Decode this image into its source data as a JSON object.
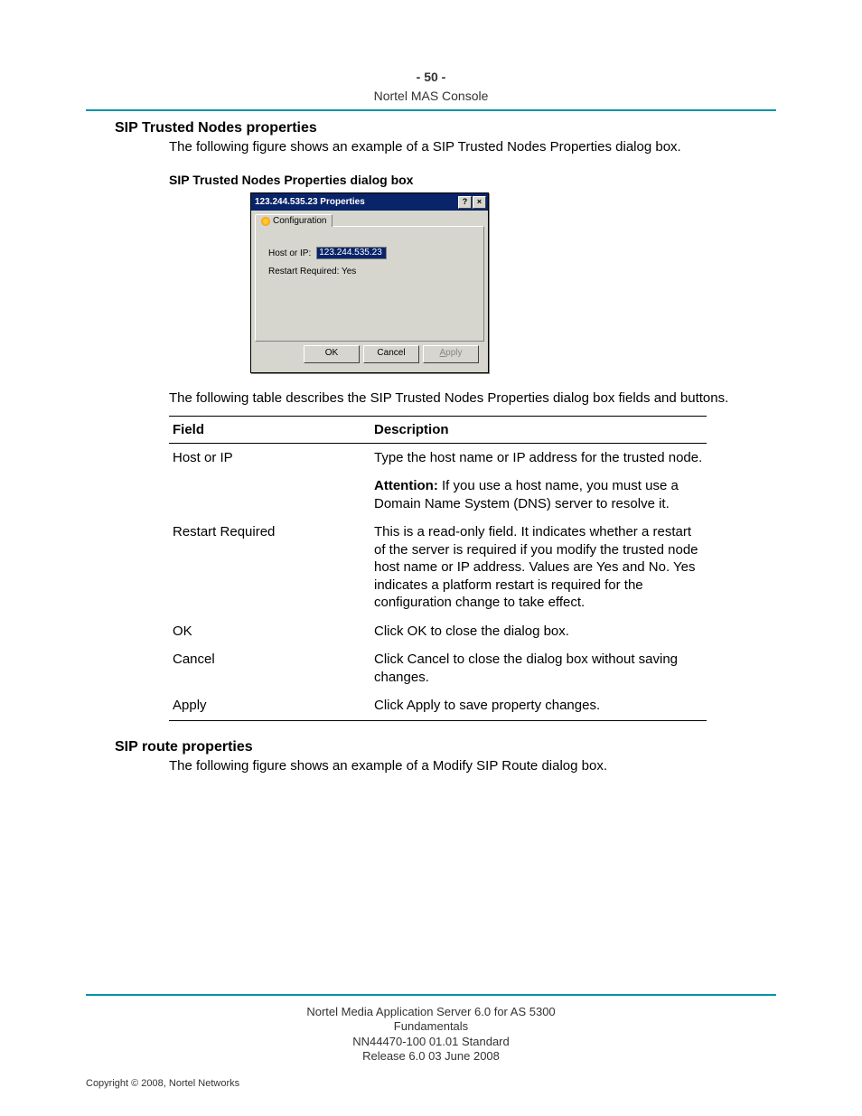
{
  "header": {
    "page_number": "- 50 -",
    "running_head": "Nortel MAS Console"
  },
  "section1": {
    "title": "SIP Trusted Nodes properties",
    "intro": "The following figure shows an example of a SIP Trusted Nodes Properties dialog box.",
    "figure_caption": "SIP Trusted Nodes Properties dialog box",
    "post_figure": "The following table describes the SIP Trusted Nodes Properties dialog box fields and buttons."
  },
  "dialog": {
    "title": "123.244.535.23 Properties",
    "help_btn": "?",
    "close_btn": "×",
    "tab_label": "Configuration",
    "field_label": "Host or IP:",
    "field_value": "123.244.535.23",
    "restart_label": "Restart Required: Yes",
    "ok": "OK",
    "cancel": "Cancel",
    "apply_prefix": "A",
    "apply_rest": "pply"
  },
  "table": {
    "head_field": "Field",
    "head_desc": "Description",
    "rows": [
      {
        "field": "Host or IP",
        "desc1": "Type the host name or IP address for the trusted node.",
        "attention_label": "Attention:",
        "attention_rest": "  If you use a host name, you must use a Domain Name System (DNS) server to resolve it."
      },
      {
        "field": "Restart Required",
        "desc1": "This is a read-only field. It indicates whether a restart of the server is required if you modify the trusted node host name or IP address. Values are Yes and No. Yes indicates a platform restart is required for the configuration change to take effect."
      },
      {
        "field": "OK",
        "desc1": "Click OK to close the dialog box."
      },
      {
        "field": "Cancel",
        "desc1": "Click Cancel to close the dialog box without saving changes."
      },
      {
        "field": "Apply",
        "desc1": "Click Apply to save property changes."
      }
    ]
  },
  "section2": {
    "title": "SIP route properties",
    "intro": "The following figure shows an example of a Modify SIP Route dialog box."
  },
  "footer": {
    "line1": "Nortel Media Application Server 6.0 for AS 5300",
    "line2": "Fundamentals",
    "line3": "NN44470-100   01.01   Standard",
    "line4": "Release 6.0   03 June 2008",
    "copyright": "Copyright © 2008, Nortel Networks"
  }
}
